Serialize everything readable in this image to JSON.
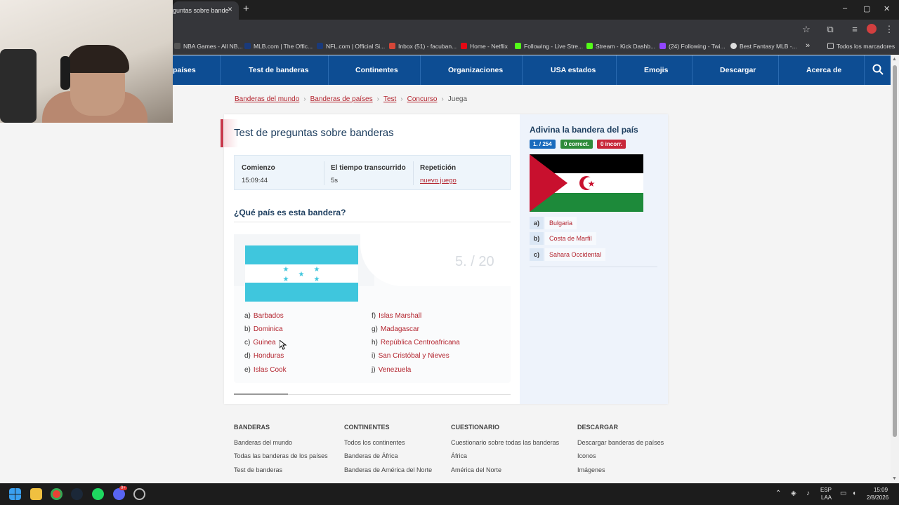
{
  "browser": {
    "tab_title": "guntas sobre bande",
    "tab_close": "×",
    "new_tab": "+",
    "window_controls": [
      "–",
      "▢",
      "✕"
    ],
    "bookmarks": [
      {
        "label": "NBA Games - All NB...",
        "color": "#333333"
      },
      {
        "label": "MLB.com | The Offic...",
        "color": "#1a3a7a"
      },
      {
        "label": "NFL.com | Official Si...",
        "color": "#1a3a7a"
      },
      {
        "label": "Inbox (51) - facuban...",
        "color": "#d44638"
      },
      {
        "label": "Home - Netflix",
        "color": "#e50914"
      },
      {
        "label": "Following - Live Stre...",
        "color": "#53fc18"
      },
      {
        "label": "Stream - Kick Dashb...",
        "color": "#53fc18"
      },
      {
        "label": "(24) Following - Twi...",
        "color": "#9146ff"
      },
      {
        "label": "Best Fantasy MLB -...",
        "color": "#dddddd"
      }
    ],
    "bookmarks_more": "»",
    "all_bookmarks": "Todos los marcadores"
  },
  "nav": {
    "items": [
      "países",
      "Test de banderas",
      "Continentes",
      "Organizaciones",
      "USA estados",
      "Emojis",
      "Descargar",
      "Acerca de"
    ]
  },
  "breadcrumb": {
    "items": [
      "Banderas del mundo",
      "Banderas de países",
      "Test",
      "Concurso"
    ],
    "current": "Juega",
    "sep": "›"
  },
  "quiz": {
    "title": "Test de preguntas sobre banderas",
    "stats": {
      "start_label": "Comienzo",
      "start_value": "15:09:44",
      "elapsed_label": "El tiempo transcurrido",
      "elapsed_value": "5s",
      "repeat_label": "Repetición",
      "repeat_link": "nuevo juego"
    },
    "question": "¿Qué país es esta bandera?",
    "counter": "5. / 20",
    "options_left": [
      {
        "letter": "a)",
        "name": "Barbados"
      },
      {
        "letter": "b)",
        "name": "Dominica"
      },
      {
        "letter": "c)",
        "name": "Guinea"
      },
      {
        "letter": "d)",
        "name": "Honduras"
      },
      {
        "letter": "e)",
        "name": "Islas Cook"
      }
    ],
    "options_right": [
      {
        "letter": "f)",
        "name": "Islas Marshall"
      },
      {
        "letter": "g)",
        "name": "Madagascar"
      },
      {
        "letter": "h)",
        "name": "República Centroafricana"
      },
      {
        "letter": "i)",
        "name": "San Cristóbal y Nieves"
      },
      {
        "letter": "j)",
        "name": "Venezuela"
      }
    ],
    "flag_colors": {
      "stripe": "#3fc6dd",
      "white": "#ffffff"
    }
  },
  "side": {
    "title": "Adivina la bandera del país",
    "badges": [
      {
        "text": "1.  / 254",
        "color": "#1a6bbd"
      },
      {
        "text": "0  correct.",
        "color": "#2e8b3a"
      },
      {
        "text": "0  incorr.",
        "color": "#c8283a"
      }
    ],
    "options": [
      {
        "letter": "a)",
        "name": "Bulgaria"
      },
      {
        "letter": "b)",
        "name": "Costa de Marfil"
      },
      {
        "letter": "c)",
        "name": "Sahara Occidental"
      }
    ]
  },
  "footer": {
    "columns": [
      {
        "heading": "BANDERAS",
        "links": [
          "Banderas del mundo",
          "Todas las banderas de los países",
          "Test de banderas"
        ]
      },
      {
        "heading": "CONTINENTES",
        "links": [
          "Todos los continentes",
          "Banderas de África",
          "Banderas de América del Norte"
        ]
      },
      {
        "heading": "CUESTIONARIO",
        "links": [
          "Cuestionario sobre todas las banderas",
          "África",
          "América del Norte"
        ]
      },
      {
        "heading": "DESCARGAR",
        "links": [
          "Descargar banderas de países",
          "Iconos",
          "Imágenes"
        ]
      }
    ]
  },
  "taskbar": {
    "lang_top": "ESP",
    "lang_bottom": "LAA",
    "time": "15:09",
    "date": "2/8/2026",
    "discord_badge": "9+"
  }
}
